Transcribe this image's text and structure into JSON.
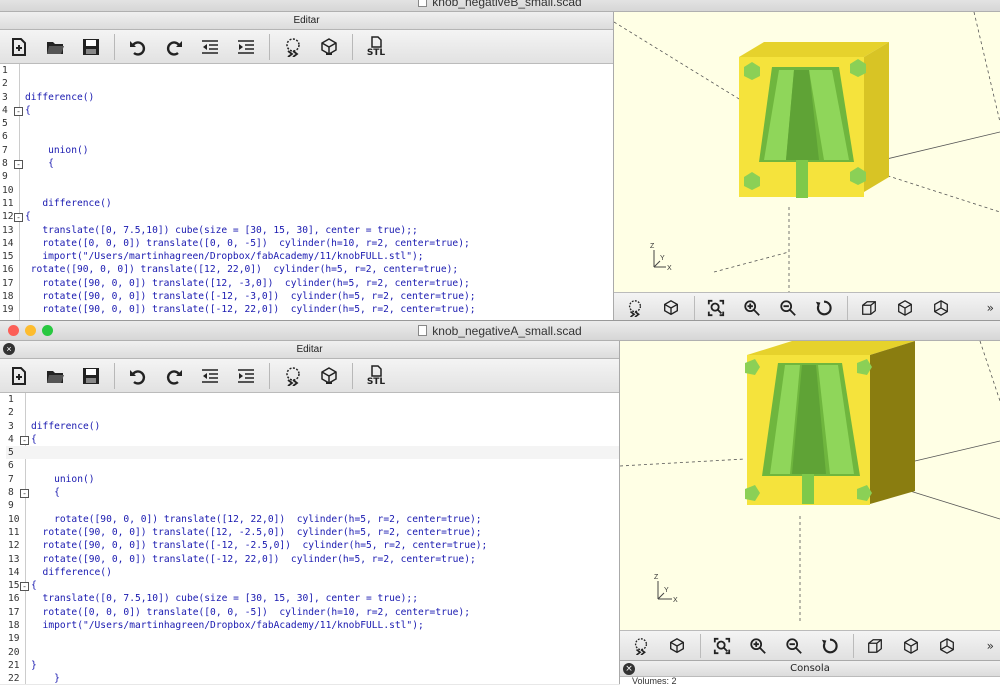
{
  "window_b": {
    "title": "knob_negativeB_small.scad",
    "editor_panel_title": "Editar",
    "lines": [
      {
        "n": "1",
        "fold": "",
        "text": ""
      },
      {
        "n": "2",
        "fold": "",
        "text": ""
      },
      {
        "n": "3",
        "fold": "",
        "text": "difference()"
      },
      {
        "n": "4",
        "fold": "-",
        "text": "{"
      },
      {
        "n": "5",
        "fold": "",
        "text": ""
      },
      {
        "n": "6",
        "fold": "",
        "text": ""
      },
      {
        "n": "7",
        "fold": "",
        "text": "    union()"
      },
      {
        "n": "8",
        "fold": "-",
        "text": "    {"
      },
      {
        "n": "9",
        "fold": "",
        "text": ""
      },
      {
        "n": "10",
        "fold": "",
        "text": ""
      },
      {
        "n": "11",
        "fold": "",
        "text": "   difference()"
      },
      {
        "n": "12",
        "fold": "-",
        "text": "{"
      },
      {
        "n": "13",
        "fold": "",
        "text": "   translate([0, 7.5,10]) cube(size = [30, 15, 30], center = true);;"
      },
      {
        "n": "14",
        "fold": "",
        "text": "   rotate([0, 0, 0]) translate([0, 0, -5])  cylinder(h=10, r=2, center=true);"
      },
      {
        "n": "15",
        "fold": "",
        "text": "   import(\"/Users/martinhagreen/Dropbox/fabAcademy/11/knobFULL.stl\");"
      },
      {
        "n": "16",
        "fold": "",
        "text": " rotate([90, 0, 0]) translate([12, 22,0])  cylinder(h=5, r=2, center=true);"
      },
      {
        "n": "17",
        "fold": "",
        "text": "   rotate([90, 0, 0]) translate([12, -3,0])  cylinder(h=5, r=2, center=true);"
      },
      {
        "n": "18",
        "fold": "",
        "text": "   rotate([90, 0, 0]) translate([-12, -3,0])  cylinder(h=5, r=2, center=true);"
      },
      {
        "n": "19",
        "fold": "",
        "text": "   rotate([90, 0, 0]) translate([-12, 22,0])  cylinder(h=5, r=2, center=true);"
      }
    ]
  },
  "window_a": {
    "title": "knob_negativeA_small.scad",
    "editor_panel_title": "Editar",
    "lines": [
      {
        "n": "1",
        "fold": "",
        "text": ""
      },
      {
        "n": "2",
        "fold": "",
        "text": ""
      },
      {
        "n": "3",
        "fold": "",
        "text": "difference()"
      },
      {
        "n": "4",
        "fold": "-",
        "text": "{"
      },
      {
        "n": "5",
        "fold": "",
        "text": ""
      },
      {
        "n": "6",
        "fold": "",
        "text": ""
      },
      {
        "n": "7",
        "fold": "",
        "text": "    union()"
      },
      {
        "n": "8",
        "fold": "-",
        "text": "    {"
      },
      {
        "n": "9",
        "fold": "",
        "text": ""
      },
      {
        "n": "10",
        "fold": "",
        "text": "    rotate([90, 0, 0]) translate([12, 22,0])  cylinder(h=5, r=2, center=true);"
      },
      {
        "n": "11",
        "fold": "",
        "text": "  rotate([90, 0, 0]) translate([12, -2.5,0])  cylinder(h=5, r=2, center=true);"
      },
      {
        "n": "12",
        "fold": "",
        "text": "  rotate([90, 0, 0]) translate([-12, -2.5,0])  cylinder(h=5, r=2, center=true);"
      },
      {
        "n": "13",
        "fold": "",
        "text": "  rotate([90, 0, 0]) translate([-12, 22,0])  cylinder(h=5, r=2, center=true);"
      },
      {
        "n": "14",
        "fold": "",
        "text": "  difference()"
      },
      {
        "n": "15",
        "fold": "-",
        "text": "{"
      },
      {
        "n": "16",
        "fold": "",
        "text": "  translate([0, 7.5,10]) cube(size = [30, 15, 30], center = true);;"
      },
      {
        "n": "17",
        "fold": "",
        "text": "  rotate([0, 0, 0]) translate([0, 0, -5])  cylinder(h=10, r=2, center=true);"
      },
      {
        "n": "18",
        "fold": "",
        "text": "  import(\"/Users/martinhagreen/Dropbox/fabAcademy/11/knobFULL.stl\");"
      },
      {
        "n": "19",
        "fold": "",
        "text": ""
      },
      {
        "n": "20",
        "fold": "",
        "text": ""
      },
      {
        "n": "21",
        "fold": "",
        "text": "}"
      },
      {
        "n": "22",
        "fold": "",
        "text": "    }"
      }
    ]
  },
  "toolbar": {
    "export_stl_label": "STL"
  },
  "console": {
    "title": "Consola",
    "text": "Volumes:      2"
  },
  "axis": {
    "x": "X",
    "y": "Y",
    "z": "Z"
  },
  "colors": {
    "model_yellow": "#f5e33c",
    "model_green": "#7ec94a",
    "viewer_bg": "#ffffe5",
    "code_text": "#1a1ab0"
  }
}
